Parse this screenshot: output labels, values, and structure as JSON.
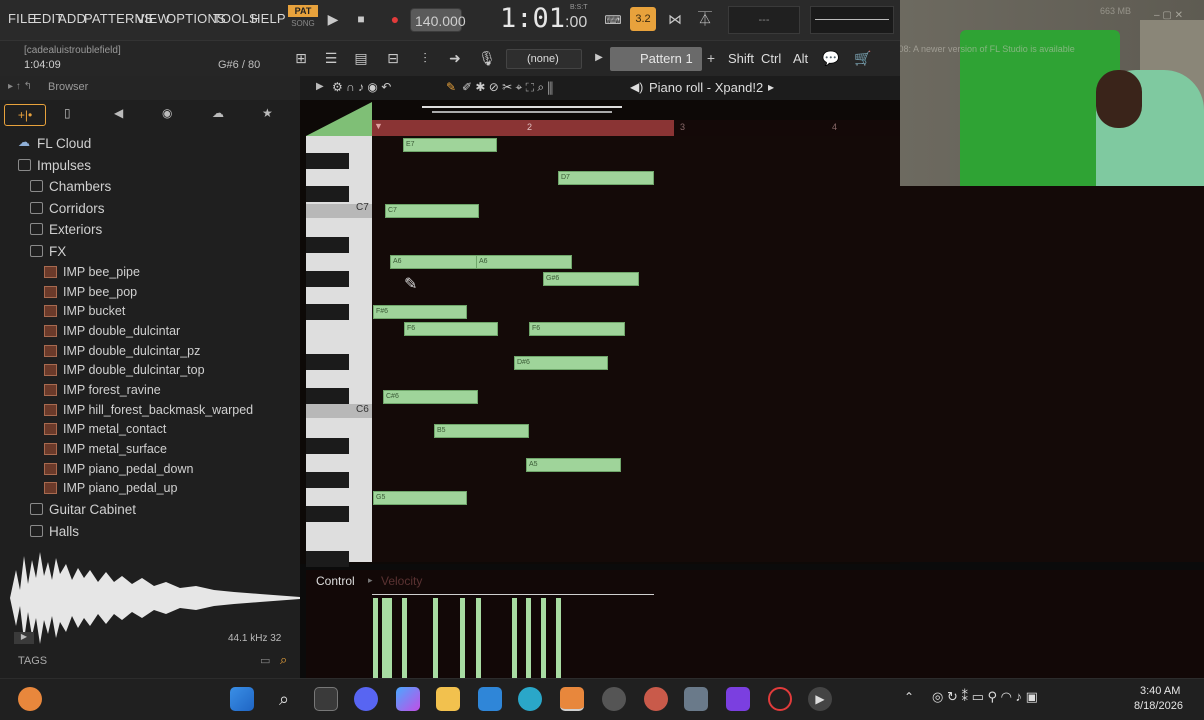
{
  "menu": [
    "FILE",
    "EDIT",
    "ADD",
    "PATTERNS",
    "VIEW",
    "OPTIONS",
    "TOOLS",
    "HELP"
  ],
  "transport": {
    "mode_top": "PAT",
    "mode_bottom": "SONG",
    "tempo": "140.000",
    "time_main": "1:01",
    "time_sub": ":00",
    "time_label": "B:S:T",
    "cpu": "3.2",
    "mem": "663 MB"
  },
  "hint": {
    "project": "[cadealuistroublefield]",
    "time": "1:04:09",
    "note": "G#6 / 80"
  },
  "channel_select": "(none)",
  "pattern_name": "Pattern 1",
  "mod_keys": [
    "Shift",
    "Ctrl",
    "Alt"
  ],
  "news": "08/08: A newer version of FL Studio is available",
  "browser": {
    "title": "Browser",
    "items": [
      {
        "label": "FL Cloud",
        "type": "cloud"
      },
      {
        "label": "Impulses",
        "type": "folder"
      },
      {
        "label": "Chambers",
        "type": "folder"
      },
      {
        "label": "Corridors",
        "type": "folder"
      },
      {
        "label": "Exteriors",
        "type": "folder"
      },
      {
        "label": "FX",
        "type": "folder"
      },
      {
        "label": "IMP bee_pipe",
        "type": "file"
      },
      {
        "label": "IMP bee_pop",
        "type": "file"
      },
      {
        "label": "IMP bucket",
        "type": "file"
      },
      {
        "label": "IMP double_dulcintar",
        "type": "file"
      },
      {
        "label": "IMP double_dulcintar_pz",
        "type": "file"
      },
      {
        "label": "IMP double_dulcintar_top",
        "type": "file"
      },
      {
        "label": "IMP forest_ravine",
        "type": "file"
      },
      {
        "label": "IMP hill_forest_backmask_warped",
        "type": "file"
      },
      {
        "label": "IMP metal_contact",
        "type": "file"
      },
      {
        "label": "IMP metal_surface",
        "type": "file"
      },
      {
        "label": "IMP piano_pedal_down",
        "type": "file"
      },
      {
        "label": "IMP piano_pedal_up",
        "type": "file"
      },
      {
        "label": "Guitar Cabinet",
        "type": "folder"
      },
      {
        "label": "Halls",
        "type": "folder"
      }
    ],
    "sample_info": "44.1 kHz 32",
    "tags_label": "TAGS"
  },
  "pianoroll": {
    "title": "Piano roll - Xpand!2",
    "bars": [
      "2",
      "3",
      "4"
    ],
    "octave_labels": [
      "C7",
      "C6"
    ],
    "notes": [
      {
        "label": "E7"
      },
      {
        "label": "D7"
      },
      {
        "label": "C7"
      },
      {
        "label": "A6"
      },
      {
        "label": "A6"
      },
      {
        "label": "G#6"
      },
      {
        "label": "F#6"
      },
      {
        "label": "F6"
      },
      {
        "label": "F6"
      },
      {
        "label": "D#6"
      },
      {
        "label": "C#6"
      },
      {
        "label": "B5"
      },
      {
        "label": "A5"
      },
      {
        "label": "G5"
      }
    ],
    "control_label": "Control",
    "control_target": "Velocity"
  },
  "clock": {
    "time": "3:40 AM",
    "date": "8/18/2026"
  },
  "colors": {
    "note": "#9fd49a",
    "timeline": "#8a3434",
    "accent": "#e8a23c",
    "grid": "#140a08"
  }
}
